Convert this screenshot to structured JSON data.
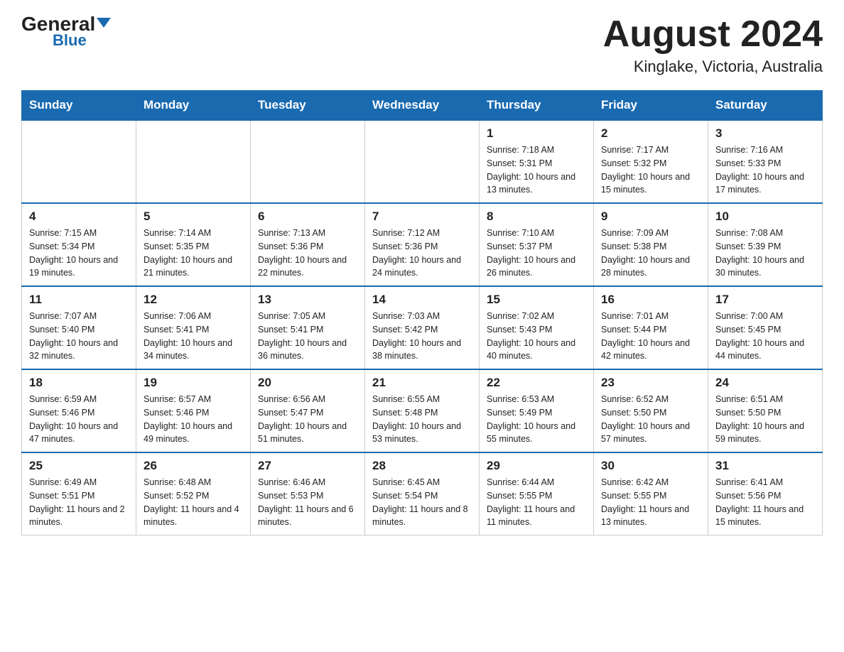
{
  "header": {
    "logo_general": "General",
    "logo_blue": "Blue",
    "month_title": "August 2024",
    "location": "Kinglake, Victoria, Australia"
  },
  "weekdays": [
    "Sunday",
    "Monday",
    "Tuesday",
    "Wednesday",
    "Thursday",
    "Friday",
    "Saturday"
  ],
  "rows": [
    [
      {
        "day": "",
        "sunrise": "",
        "sunset": "",
        "daylight": ""
      },
      {
        "day": "",
        "sunrise": "",
        "sunset": "",
        "daylight": ""
      },
      {
        "day": "",
        "sunrise": "",
        "sunset": "",
        "daylight": ""
      },
      {
        "day": "",
        "sunrise": "",
        "sunset": "",
        "daylight": ""
      },
      {
        "day": "1",
        "sunrise": "Sunrise: 7:18 AM",
        "sunset": "Sunset: 5:31 PM",
        "daylight": "Daylight: 10 hours and 13 minutes."
      },
      {
        "day": "2",
        "sunrise": "Sunrise: 7:17 AM",
        "sunset": "Sunset: 5:32 PM",
        "daylight": "Daylight: 10 hours and 15 minutes."
      },
      {
        "day": "3",
        "sunrise": "Sunrise: 7:16 AM",
        "sunset": "Sunset: 5:33 PM",
        "daylight": "Daylight: 10 hours and 17 minutes."
      }
    ],
    [
      {
        "day": "4",
        "sunrise": "Sunrise: 7:15 AM",
        "sunset": "Sunset: 5:34 PM",
        "daylight": "Daylight: 10 hours and 19 minutes."
      },
      {
        "day": "5",
        "sunrise": "Sunrise: 7:14 AM",
        "sunset": "Sunset: 5:35 PM",
        "daylight": "Daylight: 10 hours and 21 minutes."
      },
      {
        "day": "6",
        "sunrise": "Sunrise: 7:13 AM",
        "sunset": "Sunset: 5:36 PM",
        "daylight": "Daylight: 10 hours and 22 minutes."
      },
      {
        "day": "7",
        "sunrise": "Sunrise: 7:12 AM",
        "sunset": "Sunset: 5:36 PM",
        "daylight": "Daylight: 10 hours and 24 minutes."
      },
      {
        "day": "8",
        "sunrise": "Sunrise: 7:10 AM",
        "sunset": "Sunset: 5:37 PM",
        "daylight": "Daylight: 10 hours and 26 minutes."
      },
      {
        "day": "9",
        "sunrise": "Sunrise: 7:09 AM",
        "sunset": "Sunset: 5:38 PM",
        "daylight": "Daylight: 10 hours and 28 minutes."
      },
      {
        "day": "10",
        "sunrise": "Sunrise: 7:08 AM",
        "sunset": "Sunset: 5:39 PM",
        "daylight": "Daylight: 10 hours and 30 minutes."
      }
    ],
    [
      {
        "day": "11",
        "sunrise": "Sunrise: 7:07 AM",
        "sunset": "Sunset: 5:40 PM",
        "daylight": "Daylight: 10 hours and 32 minutes."
      },
      {
        "day": "12",
        "sunrise": "Sunrise: 7:06 AM",
        "sunset": "Sunset: 5:41 PM",
        "daylight": "Daylight: 10 hours and 34 minutes."
      },
      {
        "day": "13",
        "sunrise": "Sunrise: 7:05 AM",
        "sunset": "Sunset: 5:41 PM",
        "daylight": "Daylight: 10 hours and 36 minutes."
      },
      {
        "day": "14",
        "sunrise": "Sunrise: 7:03 AM",
        "sunset": "Sunset: 5:42 PM",
        "daylight": "Daylight: 10 hours and 38 minutes."
      },
      {
        "day": "15",
        "sunrise": "Sunrise: 7:02 AM",
        "sunset": "Sunset: 5:43 PM",
        "daylight": "Daylight: 10 hours and 40 minutes."
      },
      {
        "day": "16",
        "sunrise": "Sunrise: 7:01 AM",
        "sunset": "Sunset: 5:44 PM",
        "daylight": "Daylight: 10 hours and 42 minutes."
      },
      {
        "day": "17",
        "sunrise": "Sunrise: 7:00 AM",
        "sunset": "Sunset: 5:45 PM",
        "daylight": "Daylight: 10 hours and 44 minutes."
      }
    ],
    [
      {
        "day": "18",
        "sunrise": "Sunrise: 6:59 AM",
        "sunset": "Sunset: 5:46 PM",
        "daylight": "Daylight: 10 hours and 47 minutes."
      },
      {
        "day": "19",
        "sunrise": "Sunrise: 6:57 AM",
        "sunset": "Sunset: 5:46 PM",
        "daylight": "Daylight: 10 hours and 49 minutes."
      },
      {
        "day": "20",
        "sunrise": "Sunrise: 6:56 AM",
        "sunset": "Sunset: 5:47 PM",
        "daylight": "Daylight: 10 hours and 51 minutes."
      },
      {
        "day": "21",
        "sunrise": "Sunrise: 6:55 AM",
        "sunset": "Sunset: 5:48 PM",
        "daylight": "Daylight: 10 hours and 53 minutes."
      },
      {
        "day": "22",
        "sunrise": "Sunrise: 6:53 AM",
        "sunset": "Sunset: 5:49 PM",
        "daylight": "Daylight: 10 hours and 55 minutes."
      },
      {
        "day": "23",
        "sunrise": "Sunrise: 6:52 AM",
        "sunset": "Sunset: 5:50 PM",
        "daylight": "Daylight: 10 hours and 57 minutes."
      },
      {
        "day": "24",
        "sunrise": "Sunrise: 6:51 AM",
        "sunset": "Sunset: 5:50 PM",
        "daylight": "Daylight: 10 hours and 59 minutes."
      }
    ],
    [
      {
        "day": "25",
        "sunrise": "Sunrise: 6:49 AM",
        "sunset": "Sunset: 5:51 PM",
        "daylight": "Daylight: 11 hours and 2 minutes."
      },
      {
        "day": "26",
        "sunrise": "Sunrise: 6:48 AM",
        "sunset": "Sunset: 5:52 PM",
        "daylight": "Daylight: 11 hours and 4 minutes."
      },
      {
        "day": "27",
        "sunrise": "Sunrise: 6:46 AM",
        "sunset": "Sunset: 5:53 PM",
        "daylight": "Daylight: 11 hours and 6 minutes."
      },
      {
        "day": "28",
        "sunrise": "Sunrise: 6:45 AM",
        "sunset": "Sunset: 5:54 PM",
        "daylight": "Daylight: 11 hours and 8 minutes."
      },
      {
        "day": "29",
        "sunrise": "Sunrise: 6:44 AM",
        "sunset": "Sunset: 5:55 PM",
        "daylight": "Daylight: 11 hours and 11 minutes."
      },
      {
        "day": "30",
        "sunrise": "Sunrise: 6:42 AM",
        "sunset": "Sunset: 5:55 PM",
        "daylight": "Daylight: 11 hours and 13 minutes."
      },
      {
        "day": "31",
        "sunrise": "Sunrise: 6:41 AM",
        "sunset": "Sunset: 5:56 PM",
        "daylight": "Daylight: 11 hours and 15 minutes."
      }
    ]
  ]
}
